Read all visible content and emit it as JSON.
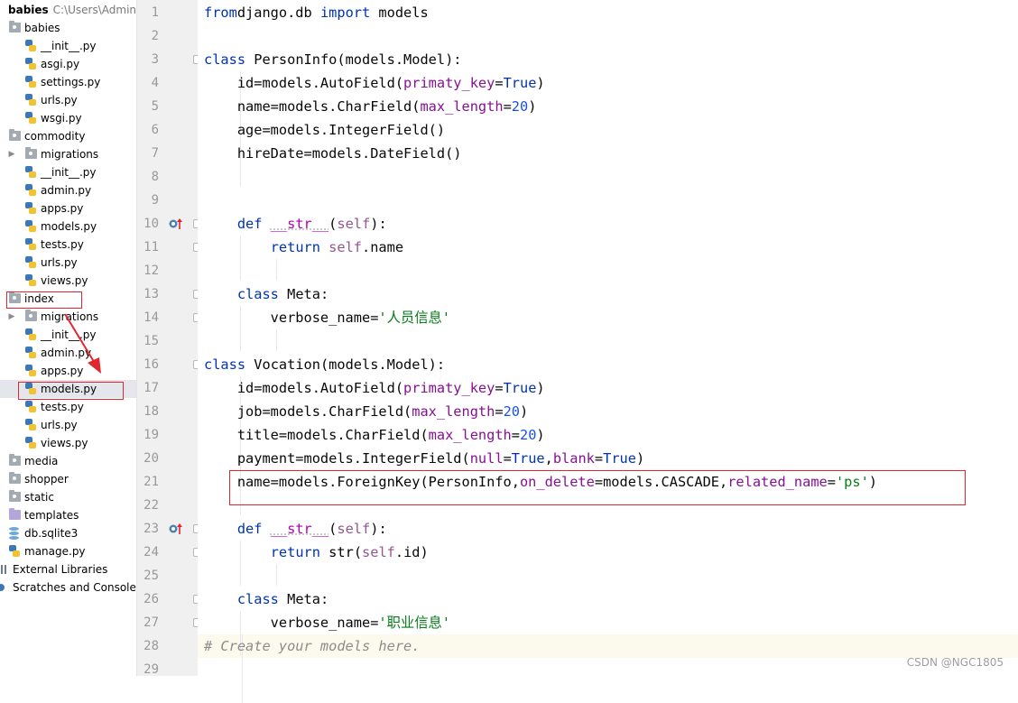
{
  "project": {
    "name": "babies",
    "path": "C:\\Users\\Admini"
  },
  "tree": [
    {
      "label": "babies",
      "kind": "folder"
    },
    {
      "label": "__init__.py",
      "kind": "py"
    },
    {
      "label": "asgi.py",
      "kind": "py"
    },
    {
      "label": "settings.py",
      "kind": "py"
    },
    {
      "label": "urls.py",
      "kind": "py"
    },
    {
      "label": "wsgi.py",
      "kind": "py"
    },
    {
      "label": "commodity",
      "kind": "folder"
    },
    {
      "label": "migrations",
      "kind": "folder"
    },
    {
      "label": "__init__.py",
      "kind": "py"
    },
    {
      "label": "admin.py",
      "kind": "py"
    },
    {
      "label": "apps.py",
      "kind": "py"
    },
    {
      "label": "models.py",
      "kind": "py"
    },
    {
      "label": "tests.py",
      "kind": "py"
    },
    {
      "label": "urls.py",
      "kind": "py"
    },
    {
      "label": "views.py",
      "kind": "py"
    },
    {
      "label": "index",
      "kind": "folder"
    },
    {
      "label": "migrations",
      "kind": "folder"
    },
    {
      "label": "__init__.py",
      "kind": "py"
    },
    {
      "label": "admin.py",
      "kind": "py"
    },
    {
      "label": "apps.py",
      "kind": "py"
    },
    {
      "label": "models.py",
      "kind": "py"
    },
    {
      "label": "tests.py",
      "kind": "py"
    },
    {
      "label": "urls.py",
      "kind": "py"
    },
    {
      "label": "views.py",
      "kind": "py"
    },
    {
      "label": "media",
      "kind": "folder"
    },
    {
      "label": "shopper",
      "kind": "folder"
    },
    {
      "label": "static",
      "kind": "folder"
    },
    {
      "label": "templates",
      "kind": "folder"
    },
    {
      "label": "db.sqlite3",
      "kind": "db"
    },
    {
      "label": "manage.py",
      "kind": "py"
    },
    {
      "label": "External Libraries",
      "kind": "lib"
    },
    {
      "label": "Scratches and Consoles",
      "kind": "scratch"
    }
  ],
  "selected_file": "models.py",
  "code": [
    {
      "n": "1",
      "t": [
        [
          "kw",
          "from"
        ],
        [
          "",
          "django.db "
        ],
        [
          "kw",
          "import"
        ],
        [
          "",
          " models"
        ]
      ]
    },
    {
      "n": "2",
      "t": []
    },
    {
      "n": "3",
      "t": [
        [
          "kw",
          "class"
        ],
        [
          "",
          " PersonInfo(models.Model):"
        ]
      ]
    },
    {
      "n": "4",
      "t": [
        [
          "",
          "    id=models.AutoField("
        ],
        [
          "kp",
          "primaty_key"
        ],
        [
          "",
          "="
        ],
        [
          "kw",
          "True"
        ],
        [
          "",
          ")"
        ]
      ]
    },
    {
      "n": "5",
      "t": [
        [
          "",
          "    name=models.CharField("
        ],
        [
          "kp",
          "max_length"
        ],
        [
          "",
          "="
        ],
        [
          "num",
          "20"
        ],
        [
          "",
          ")"
        ]
      ]
    },
    {
      "n": "6",
      "t": [
        [
          "",
          "    age=models.IntegerField()"
        ]
      ]
    },
    {
      "n": "7",
      "t": [
        [
          "",
          "    hireDate=models.DateField()"
        ]
      ]
    },
    {
      "n": "8",
      "t": []
    },
    {
      "n": "9",
      "t": []
    },
    {
      "n": "10",
      "t": [
        [
          "",
          "    "
        ],
        [
          "kw",
          "def"
        ],
        [
          "",
          " "
        ],
        [
          "dun",
          "__str__"
        ],
        [
          "",
          "("
        ],
        [
          "sf",
          "self"
        ],
        [
          "",
          "):"
        ]
      ]
    },
    {
      "n": "11",
      "t": [
        [
          "",
          "        "
        ],
        [
          "kw",
          "return"
        ],
        [
          "",
          " "
        ],
        [
          "sf",
          "self"
        ],
        [
          "",
          ".name"
        ]
      ]
    },
    {
      "n": "12",
      "t": []
    },
    {
      "n": "13",
      "t": [
        [
          "",
          "    "
        ],
        [
          "kw",
          "class"
        ],
        [
          "",
          " Meta:"
        ]
      ]
    },
    {
      "n": "14",
      "t": [
        [
          "",
          "        verbose_name="
        ],
        [
          "str",
          "'人员信息'"
        ]
      ]
    },
    {
      "n": "15",
      "t": []
    },
    {
      "n": "16",
      "t": [
        [
          "kw",
          "class"
        ],
        [
          "",
          " Vocation(models.Model):"
        ]
      ]
    },
    {
      "n": "17",
      "t": [
        [
          "",
          "    id=models.AutoField("
        ],
        [
          "kp",
          "primaty_key"
        ],
        [
          "",
          "="
        ],
        [
          "kw",
          "True"
        ],
        [
          "",
          ")"
        ]
      ]
    },
    {
      "n": "18",
      "t": [
        [
          "",
          "    job=models.CharField("
        ],
        [
          "kp",
          "max_length"
        ],
        [
          "",
          "="
        ],
        [
          "num",
          "20"
        ],
        [
          "",
          ")"
        ]
      ]
    },
    {
      "n": "19",
      "t": [
        [
          "",
          "    title=models.CharField("
        ],
        [
          "kp",
          "max_length"
        ],
        [
          "",
          "="
        ],
        [
          "num",
          "20"
        ],
        [
          "",
          ")"
        ]
      ]
    },
    {
      "n": "20",
      "t": [
        [
          "",
          "    payment=models.IntegerField("
        ],
        [
          "kp",
          "null"
        ],
        [
          "",
          "="
        ],
        [
          "kw",
          "True"
        ],
        [
          "",
          ","
        ],
        [
          "kp",
          "blank"
        ],
        [
          "",
          "="
        ],
        [
          "kw",
          "True"
        ],
        [
          "",
          ")"
        ]
      ]
    },
    {
      "n": "21",
      "t": [
        [
          "",
          "    name=models.ForeignKey(PersonInfo,"
        ],
        [
          "kp",
          "on_delete"
        ],
        [
          "",
          "=models.CASCADE,"
        ],
        [
          "kp",
          "related_name"
        ],
        [
          "",
          "="
        ],
        [
          "str",
          "'ps'"
        ],
        [
          "",
          ")"
        ]
      ]
    },
    {
      "n": "22",
      "t": []
    },
    {
      "n": "23",
      "t": [
        [
          "",
          "    "
        ],
        [
          "kw",
          "def"
        ],
        [
          "",
          " "
        ],
        [
          "dun",
          "__str__"
        ],
        [
          "",
          "("
        ],
        [
          "sf",
          "self"
        ],
        [
          "",
          "):"
        ]
      ]
    },
    {
      "n": "24",
      "t": [
        [
          "",
          "        "
        ],
        [
          "kw",
          "return"
        ],
        [
          "",
          " "
        ],
        [
          "nm",
          "str"
        ],
        [
          "",
          "("
        ],
        [
          "sf",
          "self"
        ],
        [
          "",
          ".id)"
        ]
      ]
    },
    {
      "n": "25",
      "t": []
    },
    {
      "n": "26",
      "t": [
        [
          "",
          "    "
        ],
        [
          "kw",
          "class"
        ],
        [
          "",
          " Meta:"
        ]
      ]
    },
    {
      "n": "27",
      "t": [
        [
          "",
          "        verbose_name="
        ],
        [
          "str",
          "'职业信息'"
        ]
      ]
    },
    {
      "n": "28",
      "t": [
        [
          "cm",
          "# Create your models here."
        ]
      ]
    },
    {
      "n": "29",
      "t": []
    }
  ],
  "watermark": "CSDN @NGC1805",
  "colors": {
    "keyword": "#0033b3",
    "param": "#871094",
    "self": "#94558d",
    "number": "#1750eb",
    "string": "#067d17",
    "dunder": "#b200b2",
    "comment": "#8c8c8c",
    "annotation_red": "#e0262e"
  },
  "icons": {
    "override": "override-up-arrow-icon",
    "folder": "folder-icon",
    "python_file": "python-file-icon",
    "database": "database-icon"
  }
}
